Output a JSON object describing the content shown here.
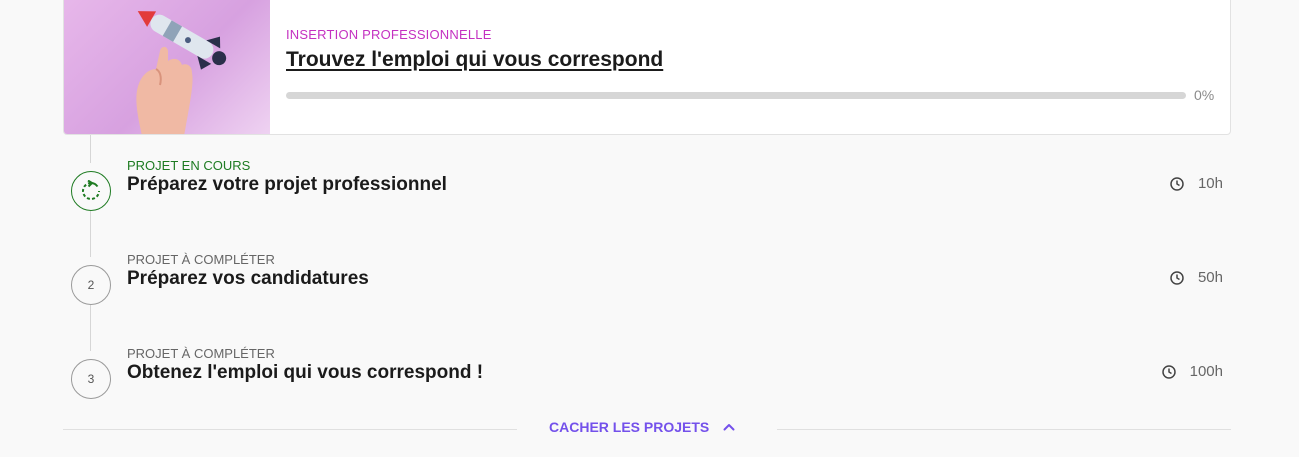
{
  "path_card": {
    "category": "INSERTION PROFESSIONNELLE",
    "title": "Trouvez l'emploi qui vous correspond",
    "progress_label": "0%",
    "progress": 0,
    "accent_color": "#c431c1",
    "progress_color": "#7451eb"
  },
  "projects": [
    {
      "status": "PROJET EN COURS",
      "title": "Préparez votre projet professionnel",
      "duration": "10h",
      "step_icon": "refresh-icon"
    },
    {
      "status": "PROJET À COMPLÉTER",
      "title": "Préparez vos candidatures",
      "duration": "50h",
      "step": "2"
    },
    {
      "status": "PROJET À COMPLÉTER",
      "title": "Obtenez l'emploi qui vous correspond !",
      "duration": "100h",
      "step": "3"
    }
  ],
  "toggle": {
    "label": "CACHER LES PROJETS",
    "icon": "chevron-up-icon"
  },
  "colors": {
    "current_status": "#1e7b22",
    "toggle": "#7451eb"
  }
}
